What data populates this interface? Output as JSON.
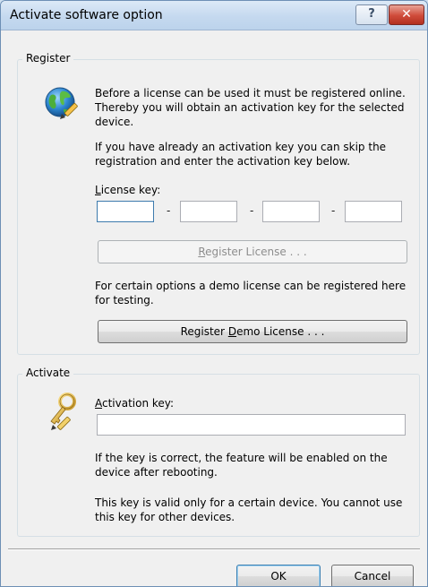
{
  "window": {
    "title": "Activate software option",
    "help_label": "?",
    "close_label": "✕"
  },
  "register": {
    "legend": "Register",
    "icon": "globe-pencil-icon",
    "intro_text": "Before a license can be used it must be registered online. Thereby you will obtain an activation key for the selected device.",
    "skip_text": "If you have already an activation key you can skip the registration and enter the activation key below.",
    "license_label_prefix": "",
    "license_label_mnemonic": "L",
    "license_label_rest": "icense key:",
    "license_fields": [
      "",
      "",
      "",
      ""
    ],
    "separator": "-",
    "register_button_prefix": "",
    "register_button_mnemonic": "R",
    "register_button_rest": "egister License . . .",
    "demo_text": "For certain options a demo license can be registered here for testing.",
    "demo_button_prefix": "Register ",
    "demo_button_mnemonic": "D",
    "demo_button_rest": "emo License . . ."
  },
  "activate": {
    "legend": "Activate",
    "icon": "key-pencil-icon",
    "key_label_mnemonic": "A",
    "key_label_rest": "ctivation key:",
    "key_value": "",
    "correct_text": "If the key is correct, the feature will be enabled on the device after rebooting.",
    "valid_text": "This key is valid only for a certain device. You cannot use this key for other devices."
  },
  "footer": {
    "ok_label": "OK",
    "cancel_label": "Cancel"
  }
}
